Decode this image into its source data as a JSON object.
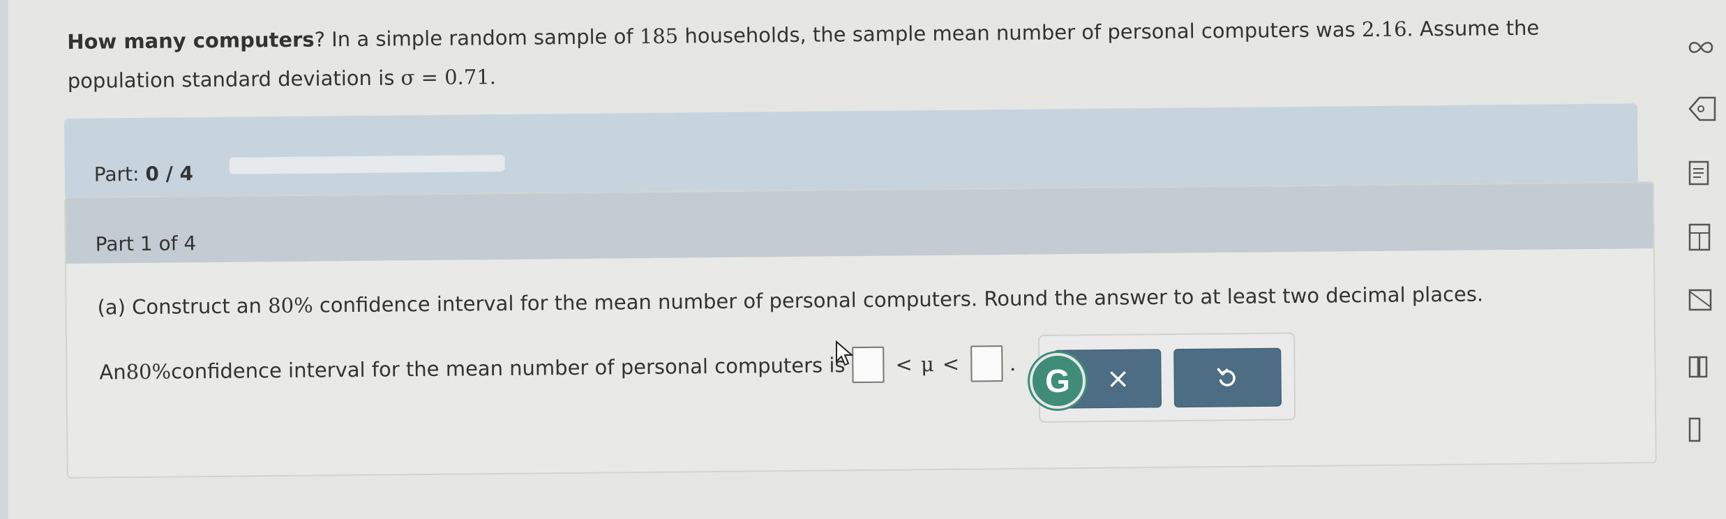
{
  "question": {
    "title": "How many computers",
    "text_part1": "? In a simple random sample of ",
    "n": "185",
    "text_part2": " households, the sample mean number of personal computers was ",
    "mean": "2.16",
    "text_part3": ". Assume the population standard deviation is ",
    "sigma_symbol": "σ",
    "equals": " = ",
    "sigma_value": "0.71",
    "end": "."
  },
  "progress": {
    "label": "Part:",
    "value": "0 / 4",
    "fraction": 0
  },
  "part": {
    "header": "Part 1 of 4",
    "instruction_prefix": "(a) Construct an ",
    "percent": "80%",
    "instruction_suffix": " confidence interval for the mean number of personal computers. Round the answer to at least two decimal places.",
    "answer_prefix": "An ",
    "answer_middle": " confidence interval for the mean number of personal computers is",
    "lt1": "<",
    "mu": "μ",
    "lt2": "<",
    "period": "."
  },
  "buttons": {
    "clear_label": "×",
    "badge_letter": "G"
  },
  "colors": {
    "button": "#4d6d85",
    "header": "#c3ccd2",
    "badge": "#3f8c78"
  },
  "icons": [
    "infinity-icon",
    "tag-icon",
    "list-icon",
    "calculator-icon",
    "mail-icon",
    "document-icon",
    "book-icon",
    "cursor-icon",
    "undo-icon",
    "grammarly-icon"
  ]
}
